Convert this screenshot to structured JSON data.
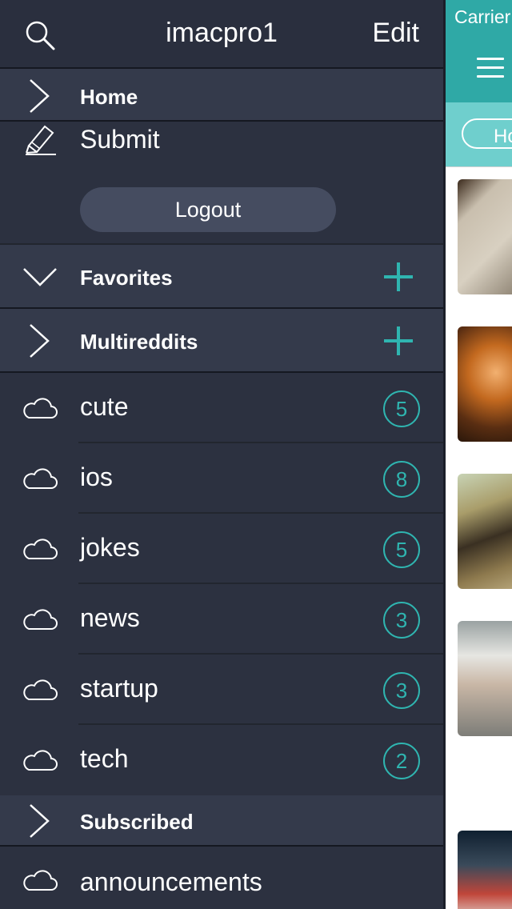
{
  "header": {
    "title": "imacpro1",
    "edit_label": "Edit",
    "search_icon": "search-icon"
  },
  "home": {
    "label": "Home",
    "icon": "chevron-right-icon"
  },
  "submit": {
    "label": "Submit",
    "icon": "pencil-icon"
  },
  "logout": {
    "label": "Logout"
  },
  "favorites": {
    "label": "Favorites",
    "icon": "chevron-down-icon",
    "add_icon": "plus-icon"
  },
  "multireddits": {
    "label": "Multireddits",
    "icon": "chevron-right-icon",
    "add_icon": "plus-icon"
  },
  "favorites_items": [
    {
      "label": "cute",
      "count": "5"
    },
    {
      "label": "ios",
      "count": "8"
    },
    {
      "label": "jokes",
      "count": "5"
    },
    {
      "label": "news",
      "count": "3"
    },
    {
      "label": "startup",
      "count": "3"
    },
    {
      "label": "tech",
      "count": "2"
    }
  ],
  "subscribed": {
    "label": "Subscribed",
    "icon": "chevron-right-icon"
  },
  "subscribed_items": [
    {
      "label": "announcements"
    }
  ],
  "main": {
    "carrier": "Carrier",
    "home_pill": "Home"
  },
  "colors": {
    "accent": "#2fb5b0",
    "drawer_bg": "#2c3140",
    "section_bg": "#343a4b",
    "teal_bar": "#2fa9a6"
  }
}
